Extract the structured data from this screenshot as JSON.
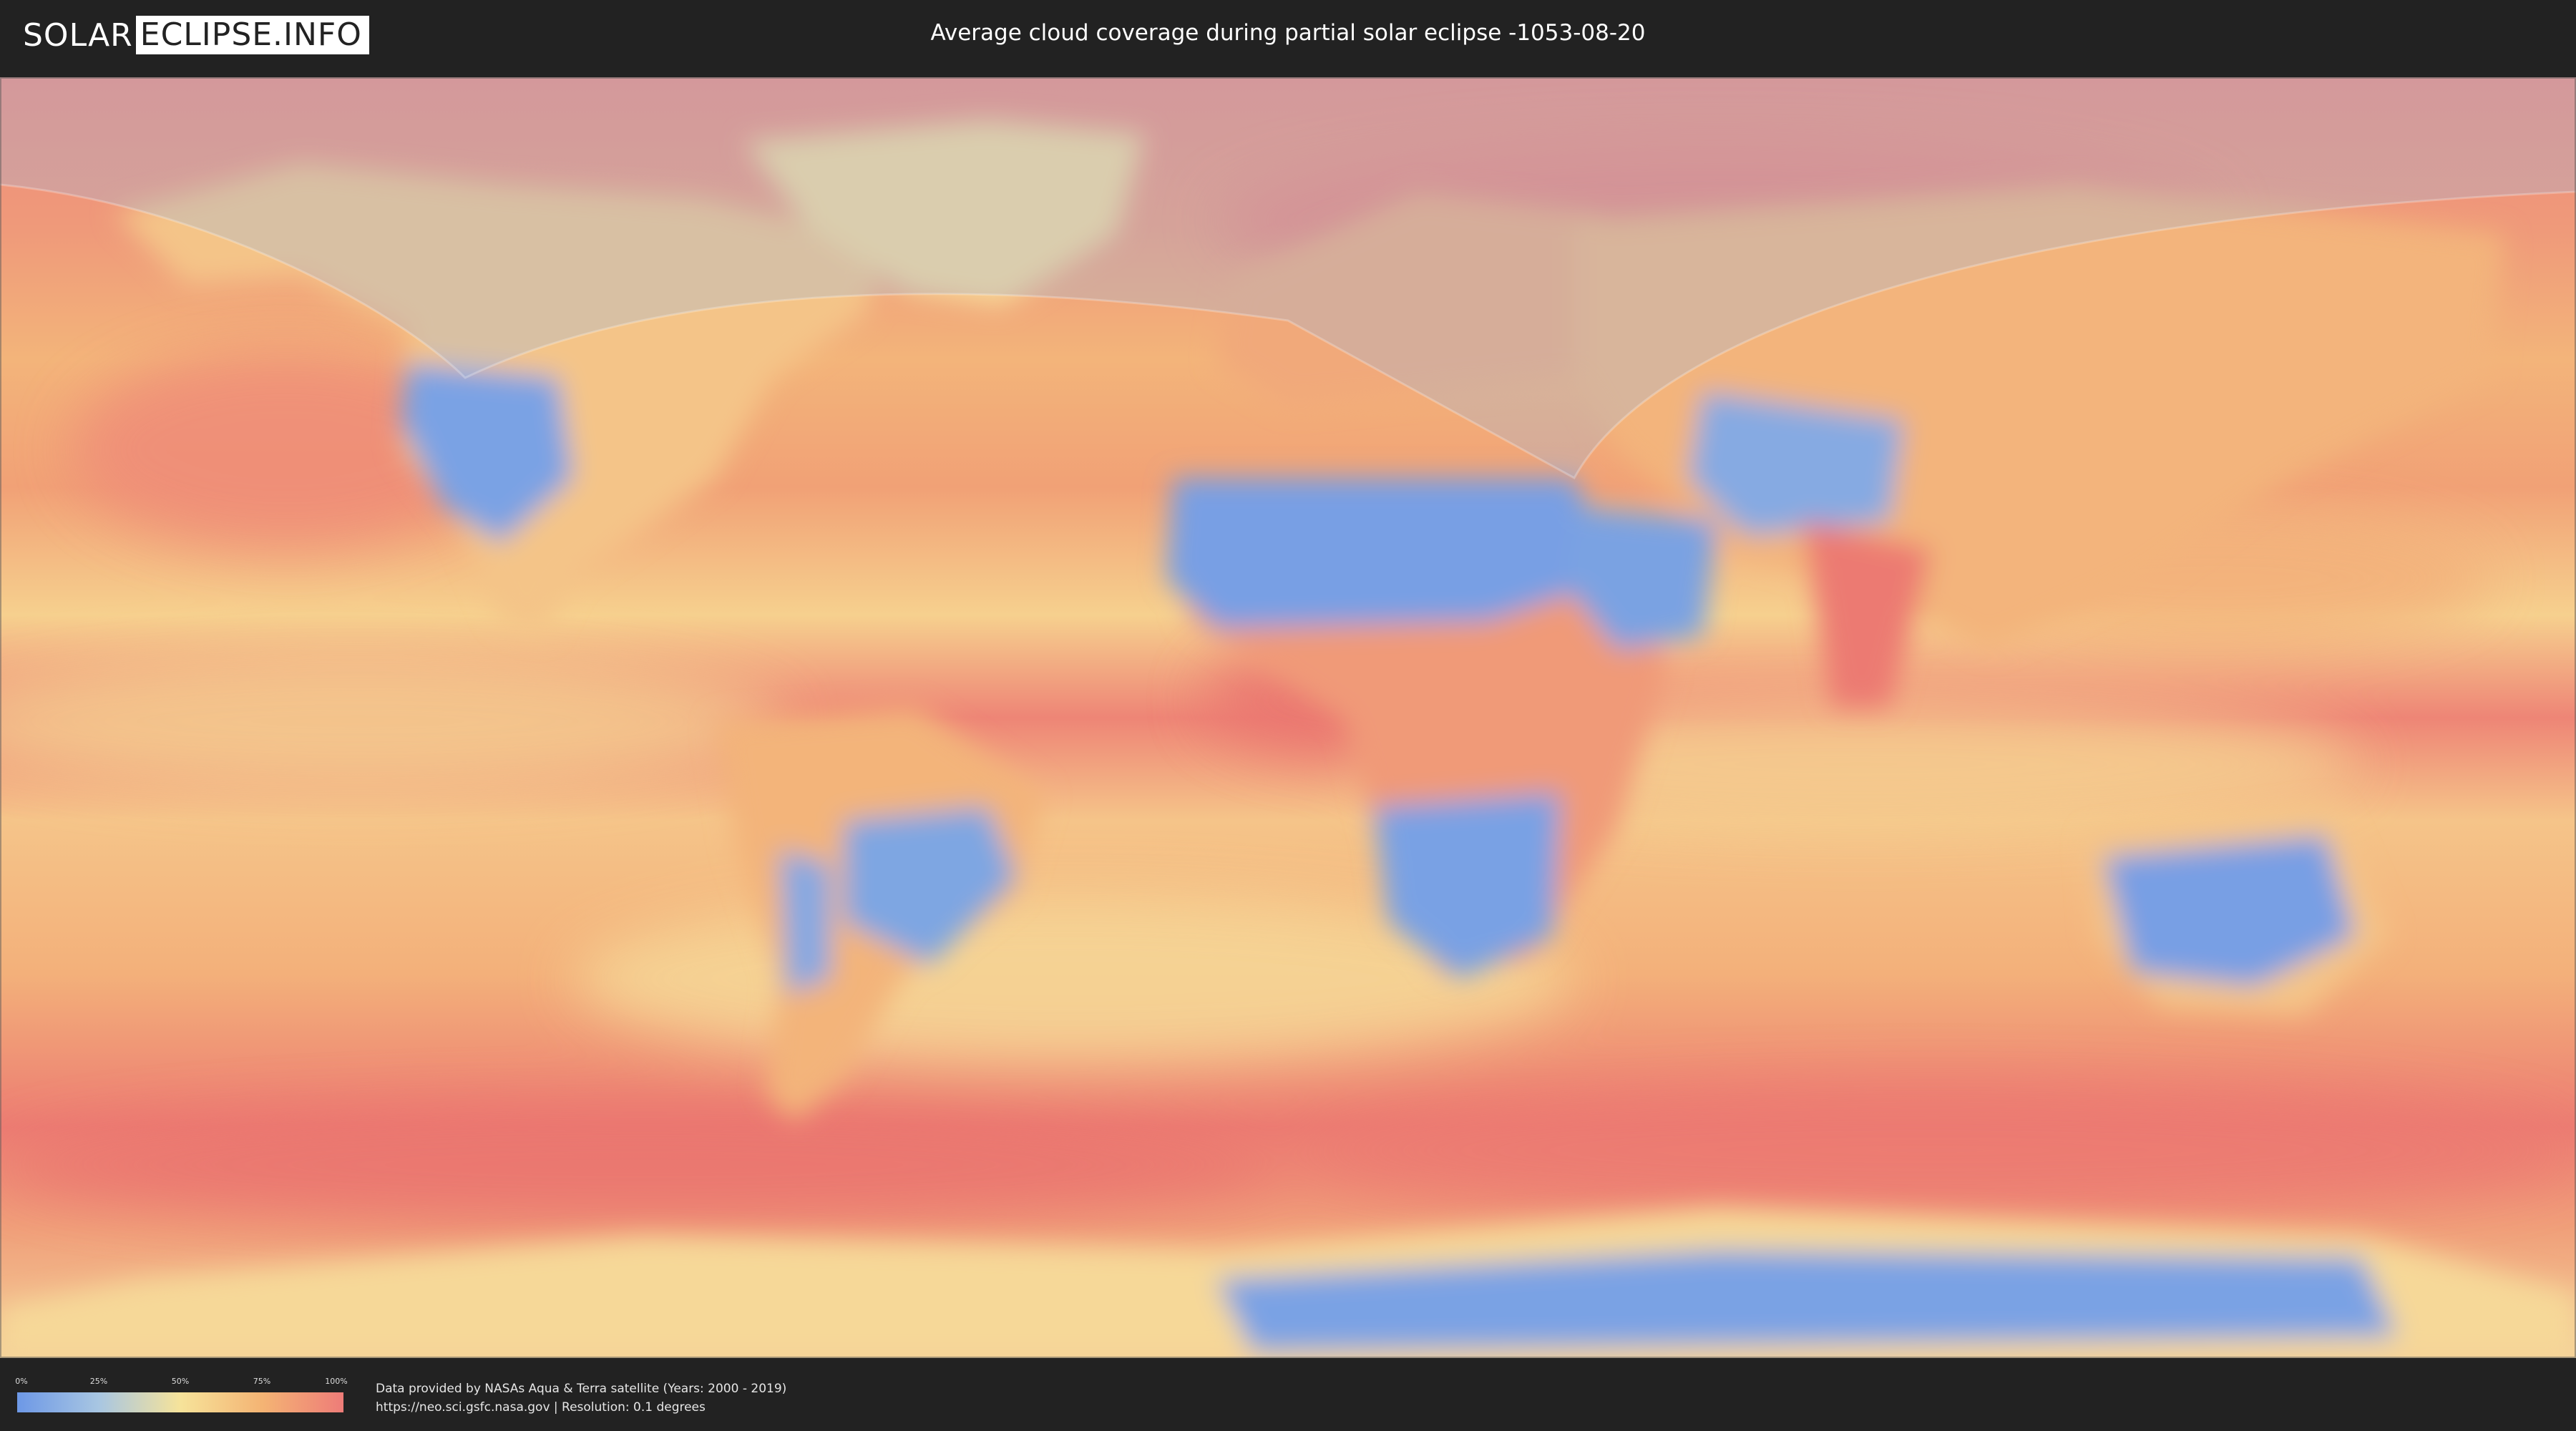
{
  "header": {
    "logo": {
      "left": "SOLAR",
      "right": "ECLIPSE.INFO"
    },
    "title": "Average cloud coverage during partial solar eclipse -1053-08-20"
  },
  "map": {
    "type": "cloud-coverage-world-map",
    "projection": "equirectangular",
    "eclipse_visibility_overlay": "translucent light band over northern hemisphere",
    "colors": {
      "clear": "#6d98e6",
      "low": "#a8c6e2",
      "medium": "#f6e39a",
      "high": "#f4b474",
      "overcast": "#ee7c78",
      "overlay": "#9fb8dc"
    }
  },
  "legend": {
    "ticks": [
      "0%",
      "25%",
      "50%",
      "75%",
      "100%"
    ]
  },
  "footer": {
    "credit_line1": "Data provided by NASAs Aqua & Terra satellite (Years: 2000 - 2019)",
    "credit_line2": "https://neo.sci.gsfc.nasa.gov | Resolution: 0.1 degrees"
  }
}
